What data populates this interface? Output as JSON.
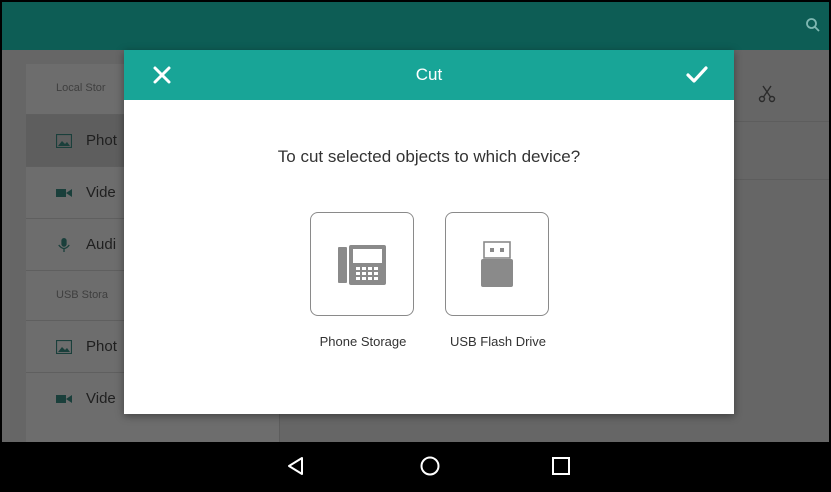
{
  "background_app": {
    "sidebar": {
      "sections": [
        {
          "title": "Local Stor",
          "items": [
            {
              "label": "Phot",
              "icon": "image-icon",
              "active": true
            },
            {
              "label": "Vide",
              "icon": "video-icon",
              "active": false
            },
            {
              "label": "Audi",
              "icon": "microphone-icon",
              "active": false
            }
          ]
        },
        {
          "title": "USB Stora",
          "items": [
            {
              "label": "Phot",
              "icon": "image-icon",
              "active": false
            },
            {
              "label": "Vide",
              "icon": "video-icon",
              "active": false
            }
          ]
        }
      ]
    },
    "header_icon": "search-icon",
    "toolbar_icon": "scissors-icon",
    "colors": {
      "header": "#0d5d55",
      "dim": "#6f6f6f"
    }
  },
  "dialog": {
    "title": "Cut",
    "question": "To cut selected objects to which device?",
    "close_icon": "close-icon",
    "confirm_icon": "check-icon",
    "header_color": "#18a597",
    "devices": [
      {
        "label": "Phone Storage",
        "icon": "desk-phone-icon"
      },
      {
        "label": "USB Flash Drive",
        "icon": "usb-drive-icon"
      }
    ]
  },
  "navbar": {
    "buttons": [
      "back-icon",
      "home-icon",
      "recent-apps-icon"
    ]
  }
}
